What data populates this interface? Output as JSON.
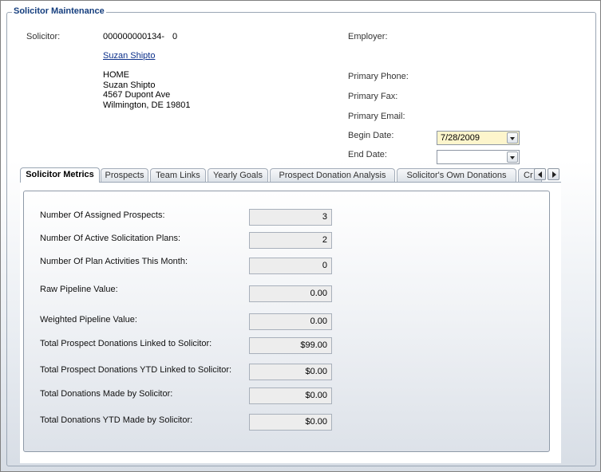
{
  "section": {
    "title": "Solicitor Maintenance"
  },
  "solicitor": {
    "label": "Solicitor:",
    "id": "000000000134-",
    "sub_id": "0",
    "name_link": "Suzan Shipto",
    "address": [
      "HOME",
      "Suzan Shipto",
      "4567 Dupont Ave",
      "Wilmington, DE 19801"
    ]
  },
  "right": {
    "employer_label": "Employer:",
    "primary_phone_label": "Primary Phone:",
    "primary_fax_label": "Primary Fax:",
    "primary_email_label": "Primary Email:",
    "begin_date_label": "Begin Date:",
    "begin_date_value": "7/28/2009",
    "end_date_label": "End Date:",
    "end_date_value": ""
  },
  "tabs": [
    {
      "label": "Solicitor Metrics",
      "active": true
    },
    {
      "label": "Prospects",
      "active": false
    },
    {
      "label": "Team Links",
      "active": false
    },
    {
      "label": "Yearly Goals",
      "active": false
    },
    {
      "label": "Prospect Donation Analysis",
      "active": false
    },
    {
      "label": "Solicitor's Own Donations",
      "active": false
    },
    {
      "label": "Cr",
      "active": false
    }
  ],
  "metrics": [
    {
      "label": "Number Of Assigned Prospects:",
      "value": "3"
    },
    {
      "label": "Number Of Active Solicitation Plans:",
      "value": "2"
    },
    {
      "label": "Number Of Plan Activities This Month:",
      "value": "0"
    },
    {
      "label": "Raw Pipeline Value:",
      "value": "0.00"
    },
    {
      "label": "Weighted Pipeline Value:",
      "value": "0.00"
    },
    {
      "label": "Total Prospect Donations Linked to Solicitor:",
      "value": "$99.00"
    },
    {
      "label": "Total Prospect Donations YTD Linked to Solicitor:",
      "value": "$0.00"
    },
    {
      "label": "Total Donations Made by Solicitor:",
      "value": "$0.00"
    },
    {
      "label": "Total Donations YTD Made by Solicitor:",
      "value": "$0.00"
    }
  ],
  "icons": {
    "date_dropdown": "chevron-down-icon",
    "tab_scroll_left": "chevron-left-icon",
    "tab_scroll_right": "chevron-right-icon"
  }
}
